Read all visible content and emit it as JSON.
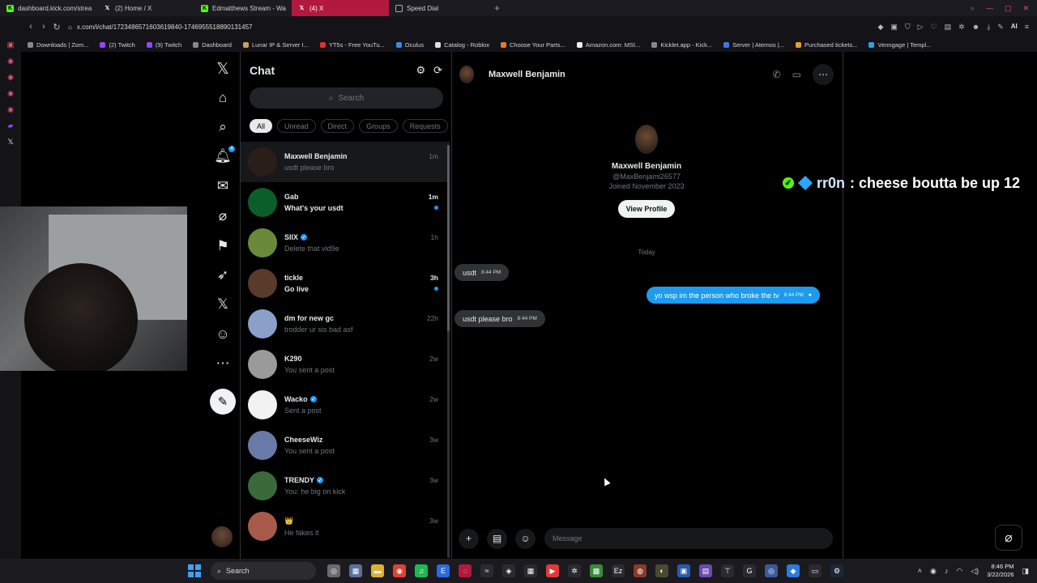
{
  "browser": {
    "tabs": [
      {
        "title": "dashboard.kick.com/strea",
        "icon": "kick-icon"
      },
      {
        "title": "(2) Home / X",
        "icon": "x-icon"
      },
      {
        "title": "Edmatthews Stream - Wa",
        "icon": "kick-icon"
      },
      {
        "title": "(4) X",
        "icon": "x-icon",
        "active": true
      },
      {
        "title": "Speed Dial",
        "icon": "speed-dial-icon"
      }
    ],
    "url": "x.com/i/chat/1723486571603619840-1746955518890131457",
    "ai_label": "AI",
    "bookmarks": [
      "Downloads | Zom...",
      "(2) Twitch",
      "(9) Twitch",
      "Dashboard",
      "Lunar IP & Server I...",
      "YT5s - Free YouTu...",
      "Oculus",
      "Catalog - Roblox",
      "Choose Your Parts...",
      "Amazon.com: MSI...",
      "Kicklet.app - Kick...",
      "Server | Aternos |...",
      "Purchased tickets...",
      "Venngage | Templ..."
    ]
  },
  "chat": {
    "title": "Chat",
    "search_placeholder": "Search",
    "notification_count": "4",
    "filters": [
      "All",
      "Unread",
      "Direct",
      "Groups",
      "Requests"
    ],
    "conversations": [
      {
        "name": "Maxwell Benjamin",
        "preview": "usdt please bro",
        "time": "1m",
        "unread": false,
        "verified": false,
        "color": "#2a1e18"
      },
      {
        "name": "Gab",
        "preview": "What's your usdt",
        "time": "1m",
        "unread": true,
        "verified": false,
        "color": "#0b5e2a"
      },
      {
        "name": "SIIX",
        "preview": "Delete that vid9e",
        "time": "1h",
        "unread": false,
        "verified": true,
        "color": "#6a8a3a"
      },
      {
        "name": "tickle",
        "preview": "Go live",
        "time": "3h",
        "unread": true,
        "verified": false,
        "color": "#5a3a2a"
      },
      {
        "name": "dm for new gc",
        "preview": "trodder ur sis bad asf",
        "time": "22h",
        "unread": false,
        "verified": false,
        "color": "#8aa0c8"
      },
      {
        "name": "K290",
        "preview": "You sent a post",
        "time": "2w",
        "unread": false,
        "verified": false,
        "color": "#9a9a9a"
      },
      {
        "name": "Wacko",
        "preview": "Sent a post",
        "time": "2w",
        "unread": false,
        "verified": true,
        "color": "#f2f2f2"
      },
      {
        "name": "CheeseWiz",
        "preview": "You sent a post",
        "time": "3w",
        "unread": false,
        "verified": false,
        "color": "#6a7aa8"
      },
      {
        "name": "TRENDY",
        "preview": "You: he big on kick",
        "time": "3w",
        "unread": false,
        "verified": true,
        "color": "#3a6a3a"
      },
      {
        "name": "👑",
        "preview": "He fakes it",
        "time": "3w",
        "unread": false,
        "verified": false,
        "color": "#a85a4a"
      }
    ]
  },
  "conversation": {
    "name": "Maxwell Benjamin",
    "handle": "@MaxBenjami26577",
    "joined": "Joined November 2023",
    "view_profile_label": "View Profile",
    "day_label": "Today",
    "messages": [
      {
        "text": "usdt",
        "time": "8:44 PM",
        "direction": "in"
      },
      {
        "text": "yo wsp im the person who broke the tv",
        "time": "8:44 PM",
        "direction": "out"
      },
      {
        "text": "usdt please bro",
        "time": "8:44 PM",
        "direction": "in"
      }
    ],
    "composer_placeholder": "Message"
  },
  "stream_overlay": {
    "username": "rr0n",
    "message": ": cheese boutta be up 12"
  },
  "taskbar": {
    "search_label": "Search",
    "time": "8:46 PM",
    "date": "3/22/2026"
  },
  "colors": {
    "accent": "#1d9bf0",
    "active_tab": "#b3183e",
    "kick_green": "#53fc18"
  }
}
